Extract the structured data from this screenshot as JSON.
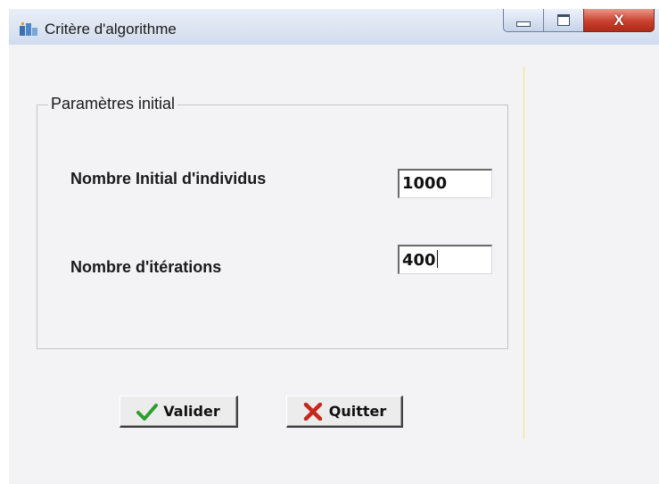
{
  "window": {
    "title": "Critère d'algorithme",
    "close_glyph": "X",
    "icons": {
      "app": "app-icon",
      "minimize": "minimize-icon",
      "maximize": "maximize-icon",
      "close": "close-icon"
    }
  },
  "groupbox": {
    "legend": "Paramètres initial",
    "fields": [
      {
        "label": "Nombre Initial d'individus",
        "value": "1000"
      },
      {
        "label": "Nombre d'itérations",
        "value": "400"
      }
    ]
  },
  "buttons": {
    "validate": {
      "label": "Valider",
      "icon": "check-icon",
      "color": "#2e9e2e"
    },
    "quit": {
      "label": "Quitter",
      "icon": "cross-icon",
      "color": "#c8281c"
    }
  }
}
